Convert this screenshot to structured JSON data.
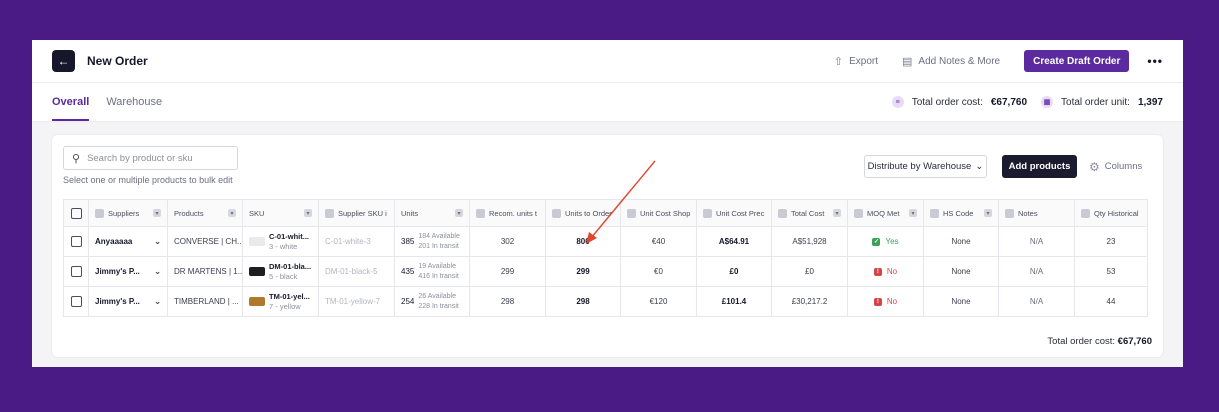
{
  "header": {
    "back_icon": "arrow-left-icon",
    "title": "New Order",
    "export_label": "Export",
    "notes_label": "Add Notes & More",
    "create_label": "Create Draft Order",
    "more_label": "•••"
  },
  "tabs": [
    {
      "label": "Overall",
      "active": true
    },
    {
      "label": "Warehouse",
      "active": false
    }
  ],
  "totals": {
    "cost_label": "Total order cost:",
    "cost_value": "€67,760",
    "unit_label": "Total order unit:",
    "unit_value": "1,397"
  },
  "toolbar": {
    "search_placeholder": "Search by product or sku",
    "hint": "Select one or multiple products to bulk edit",
    "distribute_label": "Distribute by Warehouse",
    "add_products_label": "Add products",
    "columns_label": "Columns"
  },
  "table": {
    "headers": [
      "Suppliers",
      "Products",
      "SKU",
      "Supplier SKU i",
      "Units",
      "Recom. units t",
      "Units to Order",
      "Unit Cost Shop",
      "Unit Cost Prec",
      "Total Cost",
      "MOQ Met",
      "HS Code",
      "Notes",
      "Qty Historical"
    ],
    "rows": [
      {
        "supplier": "Anyaaaaa",
        "product": "CONVERSE | CH...",
        "sku_code": "C-01-whit...",
        "sku_variant": "3 - white",
        "thumb_color": "#e9e9ee",
        "supplier_sku": "C-01-white-3",
        "units": "385",
        "available": "184 Available",
        "transit": "201 In transit",
        "recom": "302",
        "to_order": "800",
        "cost_shop": "€40",
        "cost_prec": "A$64.91",
        "total": "A$51,928",
        "moq": "Yes",
        "moq_ok": true,
        "hs": "None",
        "notes": "N/A",
        "hist": "23"
      },
      {
        "supplier": "Jimmy's P...",
        "product": "DR MARTENS | 1...",
        "sku_code": "DM-01-bla...",
        "sku_variant": "5 - black",
        "thumb_color": "#1d1d22",
        "supplier_sku": "DM-01-black-5",
        "units": "435",
        "available": "19 Available",
        "transit": "416 In transit",
        "recom": "299",
        "to_order": "299",
        "cost_shop": "€0",
        "cost_prec": "£0",
        "total": "£0",
        "moq": "No",
        "moq_ok": false,
        "hs": "None",
        "notes": "N/A",
        "hist": "53"
      },
      {
        "supplier": "Jimmy's P...",
        "product": "TIMBERLAND | ...",
        "sku_code": "TM-01-yel...",
        "sku_variant": "7 - yellow",
        "thumb_color": "#b07a2e",
        "supplier_sku": "TM-01-yellow-7",
        "units": "254",
        "available": "26 Available",
        "transit": "228 In transit",
        "recom": "298",
        "to_order": "298",
        "cost_shop": "€120",
        "cost_prec": "£101.4",
        "total": "£30,217.2",
        "moq": "No",
        "moq_ok": false,
        "hs": "None",
        "notes": "N/A",
        "hist": "44"
      }
    ]
  },
  "footer": {
    "total_label": "Total order cost:",
    "total_value": "€67,760"
  },
  "colors": {
    "background": "#4a1a85",
    "accent": "#5b2a9e",
    "dark_button": "#1a1b2e",
    "annotation_arrow": "#e0462e"
  }
}
